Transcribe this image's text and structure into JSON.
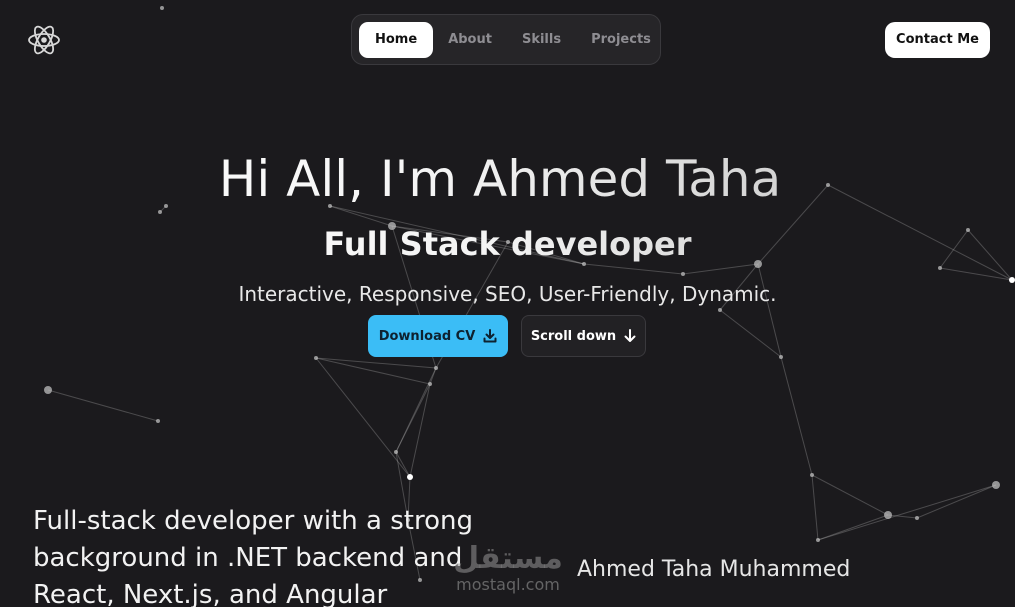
{
  "nav": {
    "items": [
      {
        "label": "Home",
        "active": true
      },
      {
        "label": "About",
        "active": false
      },
      {
        "label": "Skills",
        "active": false
      },
      {
        "label": "Projects",
        "active": false
      }
    ],
    "contact_label": "Contact Me",
    "logo_icon": "atom-react-icon"
  },
  "hero": {
    "title": "Hi All, I'm Ahmed Taha",
    "subtitle": "Full Stack developer",
    "tags": "Interactive, Responsive, SEO, User-Friendly, Dynamic.",
    "cv_button": "Download CV",
    "cv_icon": "download-icon",
    "scroll_button": "Scroll down",
    "scroll_icon": "arrow-down-icon"
  },
  "about": {
    "text": "Full-stack developer with a strong background in .NET backend and React, Next.js, and Angular"
  },
  "caption": {
    "name": "Ahmed Taha Muhammed"
  },
  "watermark": {
    "text": "mostaql.com",
    "arabic": "مستقل"
  },
  "colors": {
    "background": "#1b1a1d",
    "accent": "#3bbdf6",
    "nav_bg": "#262528"
  }
}
